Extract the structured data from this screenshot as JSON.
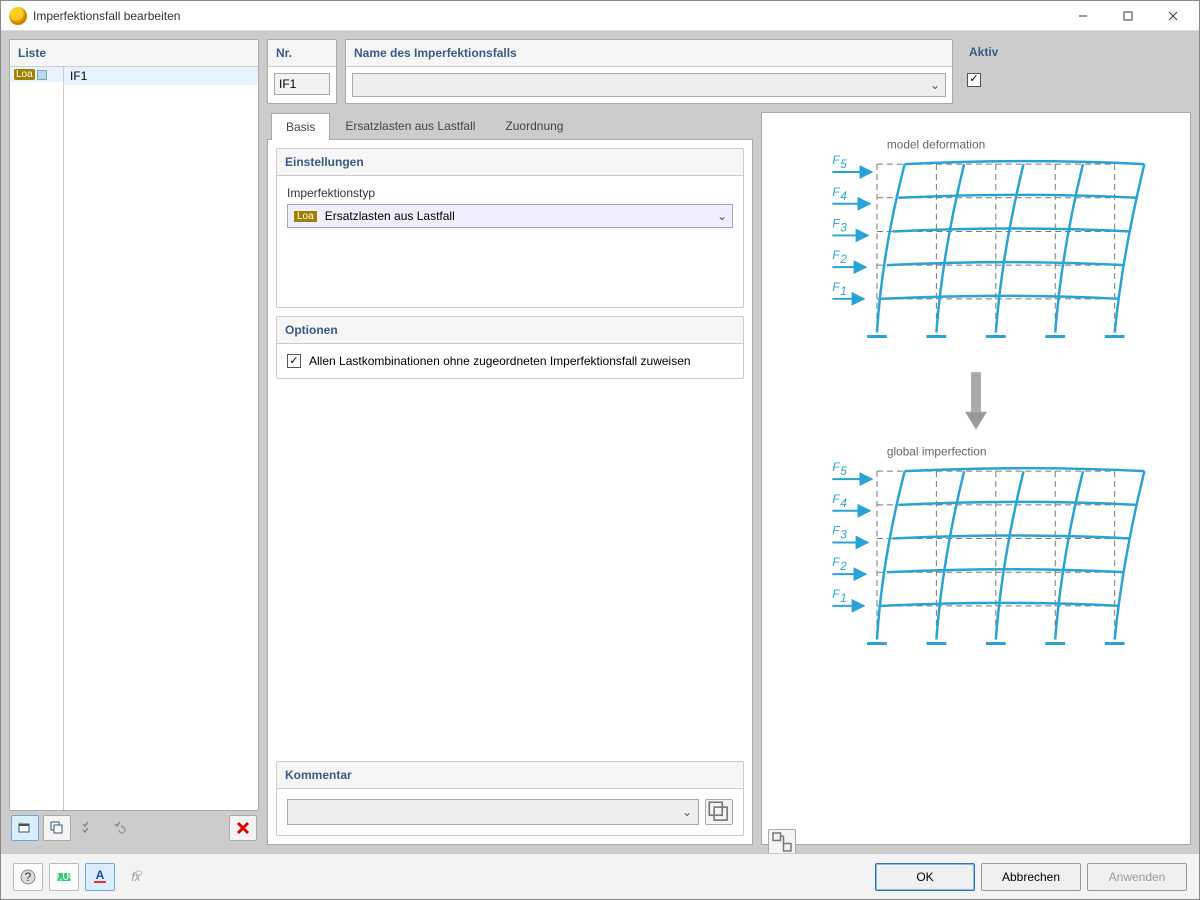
{
  "window": {
    "title": "Imperfektionsfall bearbeiten"
  },
  "list": {
    "header": "Liste",
    "typeTag": "Loa",
    "items": [
      "IF1"
    ]
  },
  "fields": {
    "nr": {
      "label": "Nr.",
      "value": "IF1"
    },
    "name": {
      "label": "Name des Imperfektionsfalls",
      "value": ""
    },
    "aktiv": {
      "label": "Aktiv",
      "checked": true
    }
  },
  "tabs": {
    "items": [
      "Basis",
      "Ersatzlasten aus Lastfall",
      "Zuordnung"
    ],
    "active": 0
  },
  "settings": {
    "header": "Einstellungen",
    "typeLabel": "Imperfektionstyp",
    "typeTag": "Loa",
    "typeValue": "Ersatzlasten aus Lastfall"
  },
  "options": {
    "header": "Optionen",
    "assignAll": {
      "label": "Allen Lastkombinationen ohne zugeordneten Imperfektionsfall zuweisen",
      "checked": true
    }
  },
  "comment": {
    "header": "Kommentar",
    "value": ""
  },
  "preview": {
    "title1": "model deformation",
    "title2": "global imperfection",
    "forces": [
      "F₅",
      "F₄",
      "F₃",
      "F₂",
      "F₁"
    ]
  },
  "buttons": {
    "ok": "OK",
    "cancel": "Abbrechen",
    "apply": "Anwenden"
  }
}
